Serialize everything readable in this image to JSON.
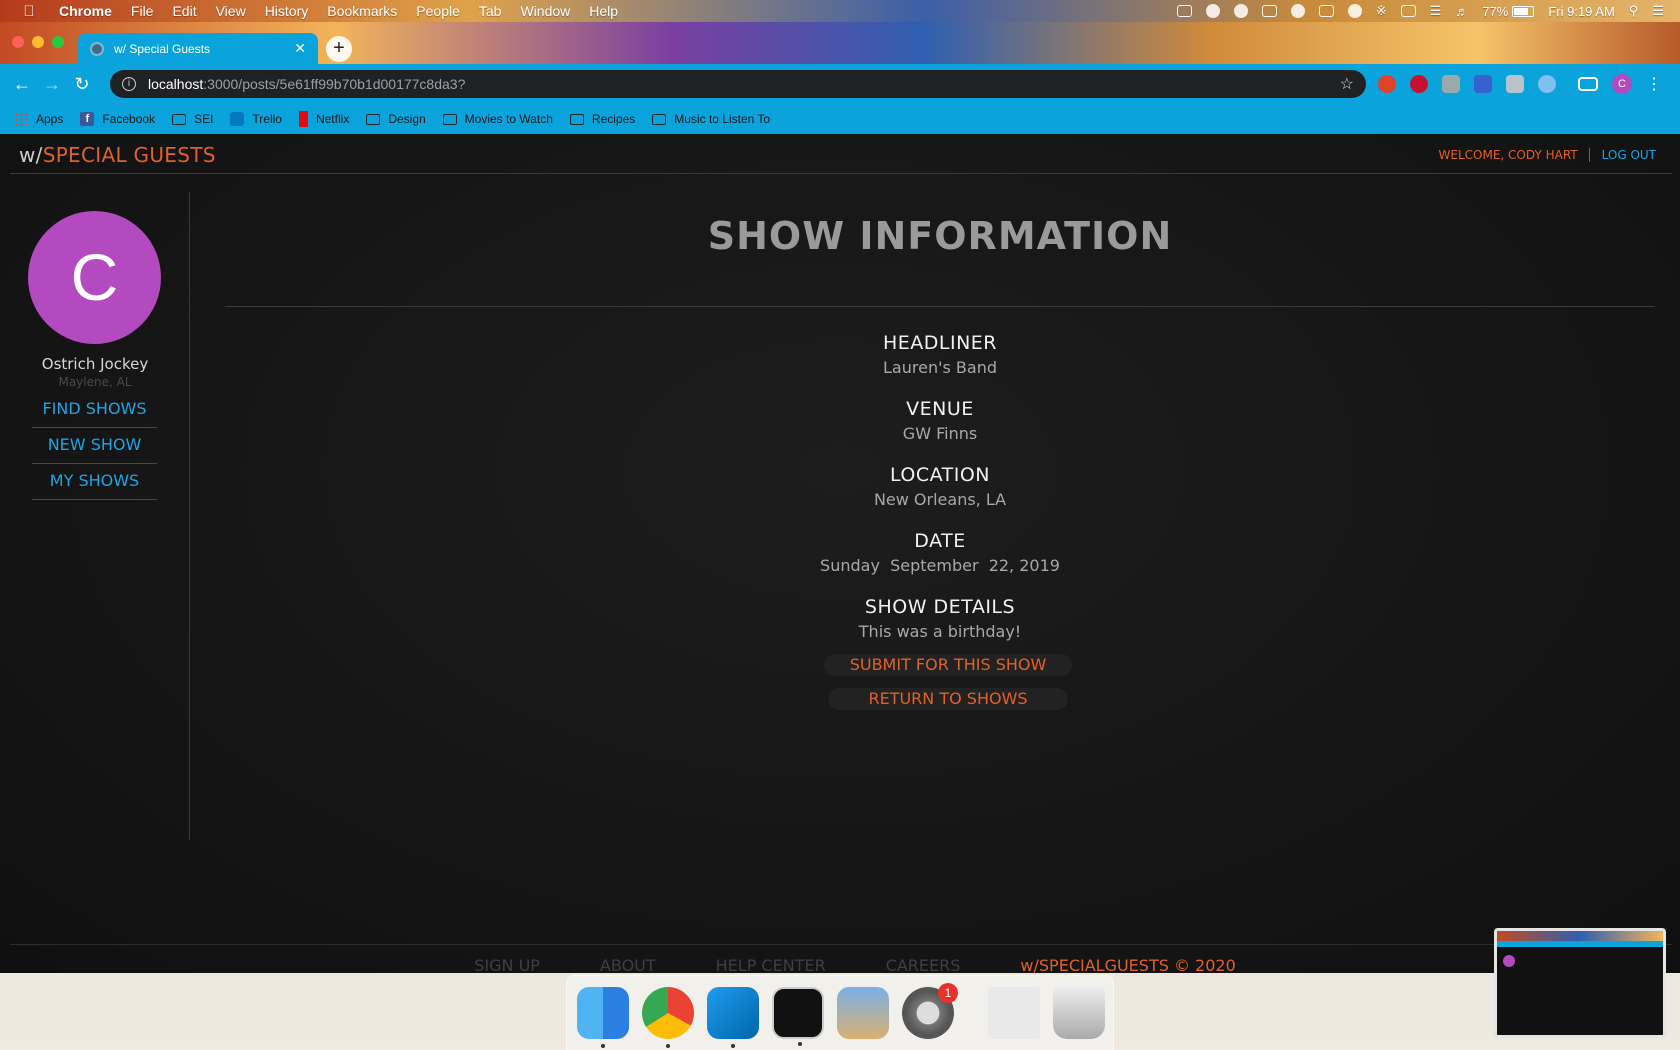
{
  "menubar": {
    "app_name": "Chrome",
    "items": [
      "File",
      "Edit",
      "View",
      "History",
      "Bookmarks",
      "People",
      "Tab",
      "Window",
      "Help"
    ],
    "battery": "77%",
    "battery_level": 0.77,
    "clock": "Fri 9:19 AM"
  },
  "browser": {
    "tab_title": "w/ Special Guests",
    "url_host": "localhost",
    "url_path": ":3000/posts/5e61ff99b70b1d00177c8da3?",
    "profile_initial": "C",
    "bookmarks": [
      "Apps",
      "Facebook",
      "SEI",
      "Trello",
      "Netflix",
      "Design",
      "Movies to Watch",
      "Recipes",
      "Music to Listen To"
    ]
  },
  "site": {
    "brand_prefix": "w/",
    "brand_name": "SPECIAL GUESTS",
    "welcome": "WELCOME, CODY HART",
    "logout": "LOG OUT"
  },
  "sidebar": {
    "avatar_initial": "C",
    "name": "Ostrich Jockey",
    "location": "Maylene, AL",
    "links": [
      "FIND SHOWS",
      "NEW SHOW",
      "MY SHOWS"
    ]
  },
  "show": {
    "title": "SHOW INFORMATION",
    "fields": [
      {
        "label": "HEADLINER",
        "value": "Lauren's Band"
      },
      {
        "label": "VENUE",
        "value": "GW Finns"
      },
      {
        "label": "LOCATION",
        "value": "New Orleans, LA"
      },
      {
        "label": "DATE",
        "value": "Sunday  September  22, 2019"
      },
      {
        "label": "SHOW DETAILS",
        "value": "This was a birthday!"
      }
    ],
    "submit_label": "SUBMIT FOR THIS SHOW",
    "return_label": "RETURN TO SHOWS"
  },
  "footer": {
    "links": [
      "SIGN UP",
      "ABOUT",
      "HELP CENTER",
      "CAREERS"
    ],
    "copyright": "w/SPECIALGUESTS © 2020"
  },
  "dock": {
    "badge_count": "1"
  },
  "colors": {
    "accent_orange": "#e0612a",
    "link_blue": "#1aa6e6",
    "avatar_purple": "#b44ac0",
    "chrome_blue": "#0aa3dc"
  }
}
